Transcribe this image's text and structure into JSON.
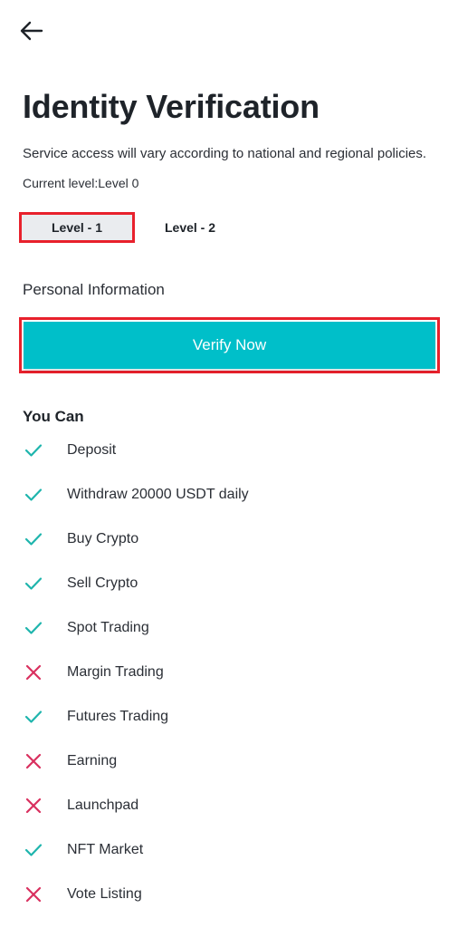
{
  "header": {
    "back_icon": "arrow-left-icon",
    "title": "Identity Verification",
    "subtitle": "Service access will vary according to national and regional policies.",
    "current_level": "Current level:Level 0"
  },
  "tabs": [
    {
      "label": "Level - 1",
      "selected": true
    },
    {
      "label": "Level - 2",
      "selected": false
    }
  ],
  "section": {
    "label": "Personal Information",
    "verify_label": "Verify Now"
  },
  "features": {
    "heading": "You Can",
    "items": [
      {
        "label": "Deposit",
        "allowed": true
      },
      {
        "label": "Withdraw 20000 USDT daily",
        "allowed": true
      },
      {
        "label": "Buy Crypto",
        "allowed": true
      },
      {
        "label": "Sell Crypto",
        "allowed": true
      },
      {
        "label": "Spot Trading",
        "allowed": true
      },
      {
        "label": "Margin Trading",
        "allowed": false
      },
      {
        "label": "Futures Trading",
        "allowed": true
      },
      {
        "label": "Earning",
        "allowed": false
      },
      {
        "label": "Launchpad",
        "allowed": false
      },
      {
        "label": "NFT Market",
        "allowed": true
      },
      {
        "label": "Vote Listing",
        "allowed": false
      }
    ]
  },
  "colors": {
    "accent": "#00bfc9",
    "check": "#1fb5ad",
    "cross": "#d9305f",
    "highlight": "#e8212c"
  }
}
